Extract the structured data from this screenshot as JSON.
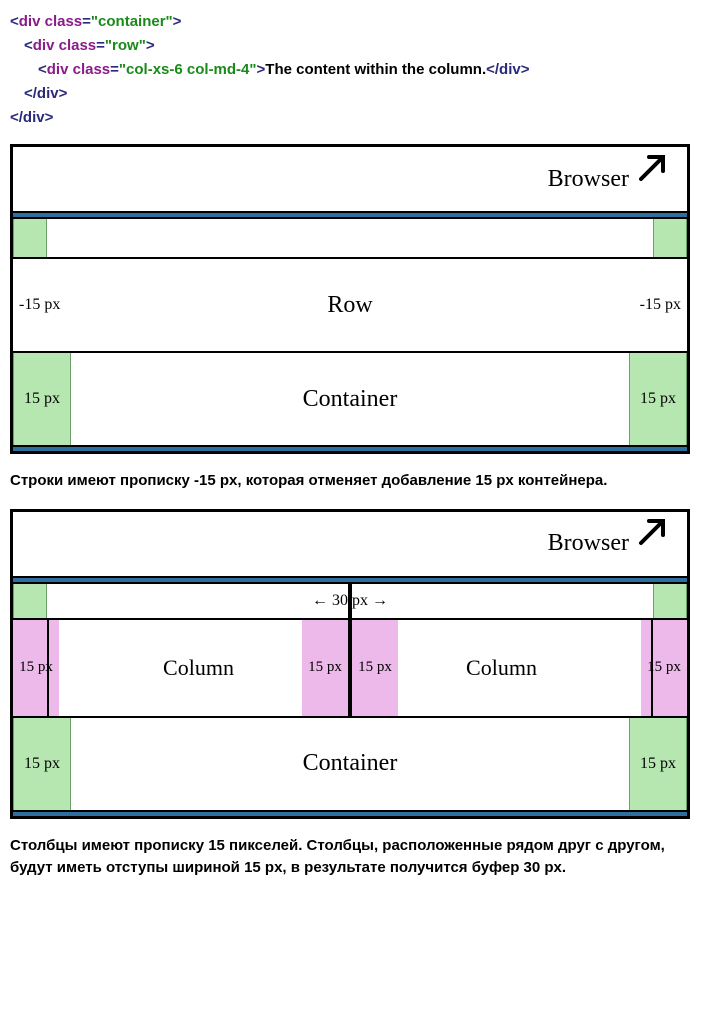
{
  "code": {
    "line1_open": "<div ",
    "class_attr": "class",
    "eq": "=",
    "container_val": "\"container\"",
    "row_val": "\"row\"",
    "col_val": "\"col-xs-6 col-md-4\"",
    "close_tag": ">",
    "content_text": "The content within the column.",
    "div_close": "</div>"
  },
  "diagram1": {
    "browser": "Browser",
    "row": "Row",
    "container": "Container",
    "neg15": "-15 px",
    "pos15": "15 px"
  },
  "para1": "Строки имеют прописку -15 px, которая отменяет добавление 15 px контейнера.",
  "diagram2": {
    "browser": "Browser",
    "gap": "30 px",
    "column": "Column",
    "container": "Container",
    "pad": "15 px"
  },
  "para2": "Столбцы имеют прописку 15 пикселей. Столбцы, расположенные рядом друг с другом, будут иметь отступы шириной 15 px, в результате получится буфер 30 px."
}
